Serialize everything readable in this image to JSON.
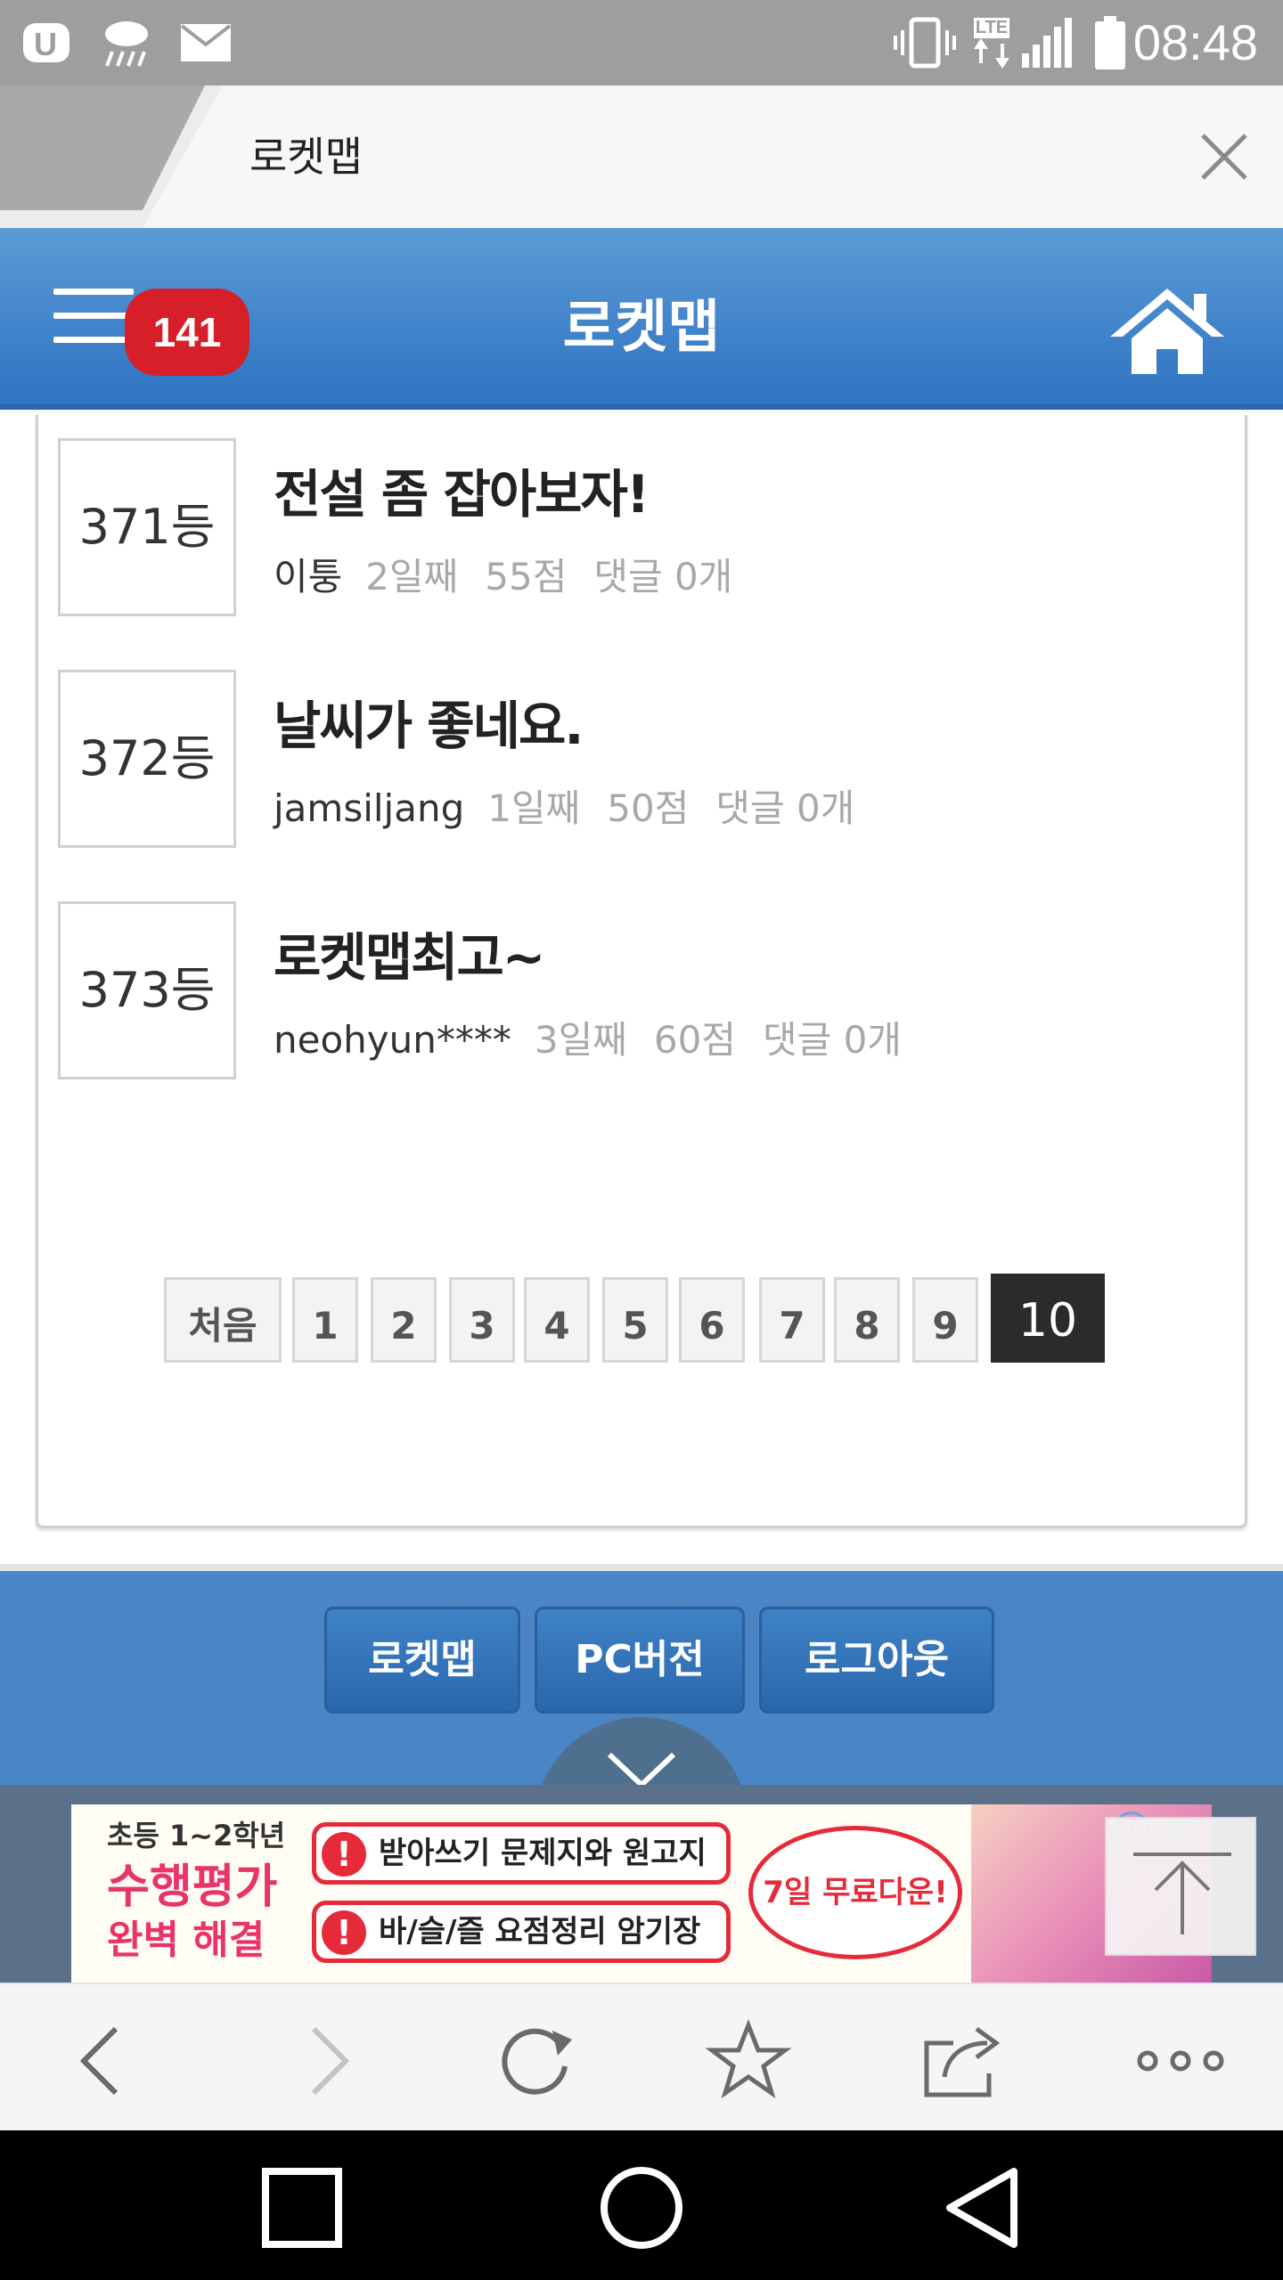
{
  "status_bar": {
    "time": "08:48",
    "icons": [
      "carrier-u-icon",
      "weather-rain-icon",
      "mail-icon",
      "vibrate-icon",
      "lte-icon",
      "signal-icon",
      "battery-icon"
    ],
    "lte_label": "LTE"
  },
  "browser_tab": {
    "title": "로켓맵"
  },
  "site_header": {
    "title": "로켓맵",
    "notification_count": "141"
  },
  "posts": [
    {
      "rank": "371등",
      "title": "전설 좀 잡아보자!",
      "author": "이퉁",
      "days": "2일째",
      "score": "55점",
      "comments": "댓글 0개"
    },
    {
      "rank": "372등",
      "title": "날씨가 좋네요.",
      "author": "jamsiljang",
      "days": "1일째",
      "score": "50점",
      "comments": "댓글 0개"
    },
    {
      "rank": "373등",
      "title": "로켓맵최고~",
      "author": "neohyun****",
      "days": "3일째",
      "score": "60점",
      "comments": "댓글 0개"
    }
  ],
  "pagination": {
    "first_label": "처음",
    "pages": [
      "1",
      "2",
      "3",
      "4",
      "5",
      "6",
      "7",
      "8",
      "9",
      "10"
    ],
    "current": "10"
  },
  "footer": {
    "buttons": [
      "로켓맵",
      "PC버전",
      "로그아웃"
    ]
  },
  "ad": {
    "line1": "초등 1~2학년",
    "line2": "수행평가",
    "line3": "완벽 해결",
    "pill1": "받아쓰기 문제지와 원고지",
    "pill2": "바/슬/즐 요점정리 암기장",
    "bubble": "7일 무료다운!",
    "info": "i",
    "close": "✕"
  },
  "colors": {
    "header_blue": "#2f73c2",
    "badge_red": "#d71f2a",
    "footer_blue": "#4a86c6",
    "current_page": "#2b2b2b"
  }
}
